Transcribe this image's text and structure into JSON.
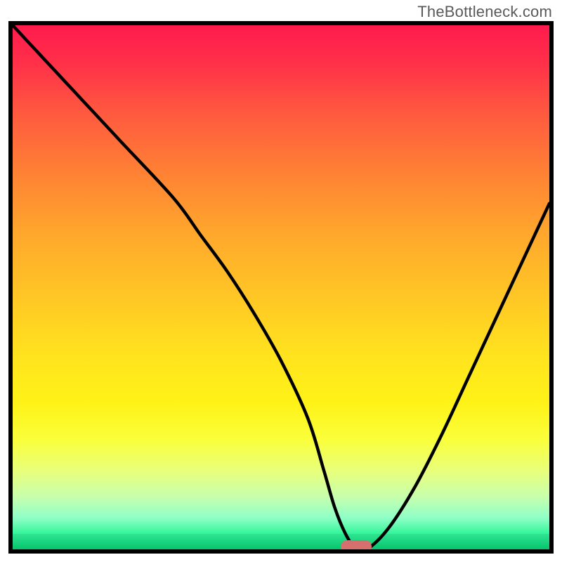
{
  "attribution": "TheBottleneck.com",
  "chart_data": {
    "type": "line",
    "title": "",
    "xlabel": "",
    "ylabel": "",
    "xlim": [
      0,
      100
    ],
    "ylim": [
      0,
      100
    ],
    "x": [
      0,
      10,
      20,
      30,
      35,
      40,
      45,
      50,
      55,
      58,
      60,
      62,
      64,
      66,
      70,
      75,
      80,
      85,
      90,
      95,
      100
    ],
    "y": [
      100,
      89,
      78,
      67,
      60,
      53,
      45,
      36,
      25,
      15,
      8,
      3,
      0,
      0,
      4,
      12,
      22,
      33,
      44,
      55,
      66
    ],
    "minimum_x": 64,
    "marker": {
      "x": 64,
      "y": 0.5
    },
    "gradient_top_color": "#ff1a4d",
    "gradient_bottom_color": "#06c46c"
  }
}
